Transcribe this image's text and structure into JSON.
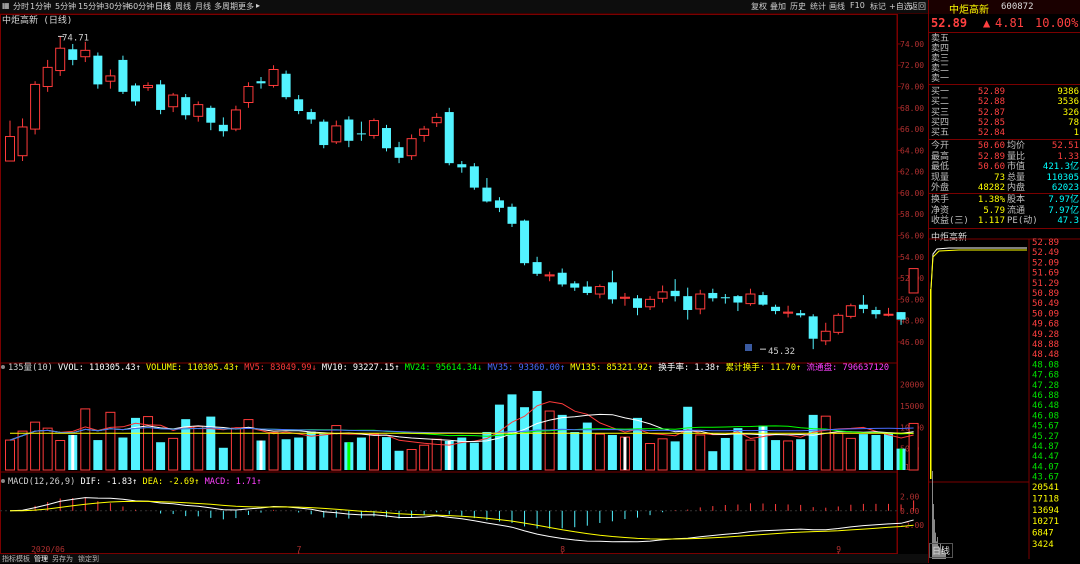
{
  "toolbar": {
    "left_items": [
      "分时",
      "1分钟",
      "5分钟",
      "15分钟",
      "30分钟",
      "60分钟",
      "日线",
      "周线",
      "月线",
      "多周期",
      "更多"
    ],
    "right_items": [
      "复权",
      "叠加",
      "历史",
      "统计",
      "画线",
      "F10",
      "标记",
      "+自选",
      "返回"
    ]
  },
  "chart": {
    "title": "中炬高新 (日线)",
    "high_label": "74.71",
    "low_label": "45.32",
    "price_axis": [
      "74.00",
      "72.00",
      "70.00",
      "68.00",
      "66.00",
      "64.00",
      "62.00",
      "60.00",
      "58.00",
      "56.00",
      "54.00",
      "52.00",
      "50.00",
      "48.00",
      "46.00"
    ],
    "date_ticks": [
      "2020/06",
      "7",
      "8",
      "9"
    ]
  },
  "volume": {
    "title": "135量(10)",
    "vvol_label": "VVOL:",
    "vvol_value": "110305.43",
    "volume_label": "VOLUME:",
    "volume_value": "110305.43",
    "mv5_label": "MV5:",
    "mv5_value": "83049.99",
    "mv10_label": "MV10:",
    "mv10_value": "93227.15",
    "mv24_label": "MV24:",
    "mv24_value": "95614.34",
    "mv35_label": "MV35:",
    "mv35_value": "93360.00",
    "mv135_label": "MV135:",
    "mv135_value": "85321.92",
    "turnover_label": "换手率:",
    "turnover_value": "1.38",
    "cum_turnover_label": "累计换手:",
    "cum_turnover_value": "11.70",
    "float_label": "流通盘:",
    "float_value": "796637120",
    "axis": [
      "20000",
      "15000",
      "10000",
      "5000"
    ],
    "unit": "X10"
  },
  "macd": {
    "title": "MACD(12,26,9)",
    "dif_label": "DIF:",
    "dif_value": "-1.83",
    "dea_label": "DEA:",
    "dea_value": "-2.69",
    "macd_label": "MACD:",
    "macd_value": "1.71",
    "axis": [
      "2.00",
      "0.00",
      "-2.00"
    ]
  },
  "bottom_tabs": [
    "指标",
    "模板",
    "管理",
    "另存为",
    "锁定到"
  ],
  "quote": {
    "name": "中炬高新",
    "code": "600872",
    "price": "52.89",
    "change": "4.81",
    "pct": "10.00%",
    "sell_labels": [
      "卖五",
      "卖四",
      "卖三",
      "卖二",
      "卖一"
    ],
    "buy": [
      {
        "label": "买一",
        "price": "52.89",
        "qty": "9386"
      },
      {
        "label": "买二",
        "price": "52.88",
        "qty": "3536"
      },
      {
        "label": "买三",
        "price": "52.87",
        "qty": "326"
      },
      {
        "label": "买四",
        "price": "52.85",
        "qty": "78"
      },
      {
        "label": "买五",
        "price": "52.84",
        "qty": "1"
      }
    ],
    "stats": [
      {
        "l1": "今开",
        "v1": "50.60",
        "l2": "均价",
        "v2": "52.51"
      },
      {
        "l1": "最高",
        "v1": "52.89",
        "l2": "量比",
        "v2": "1.33"
      },
      {
        "l1": "最低",
        "v1": "50.60",
        "l2": "市值",
        "v2": "421.3亿"
      },
      {
        "l1": "现量",
        "v1": "73",
        "l2": "总量",
        "v2": "110305"
      },
      {
        "l1": "外盘",
        "v1": "48282",
        "l2": "内盘",
        "v2": "62023"
      }
    ],
    "stats2": [
      {
        "l1": "换手",
        "v1": "1.38%",
        "l2": "股本",
        "v2": "7.97亿"
      },
      {
        "l1": "净资",
        "v1": "5.79",
        "l2": "流通",
        "v2": "7.97亿"
      },
      {
        "l1": "收益(三)",
        "v1": "1.117",
        "l2": "PE(动)",
        "v2": "47.3"
      }
    ],
    "mini_title": "中炬高新",
    "mini_axis": [
      "52.89",
      "52.49",
      "52.09",
      "51.69",
      "51.29",
      "50.89",
      "50.49",
      "50.09",
      "49.68",
      "49.28",
      "48.88",
      "48.48",
      "48.08",
      "47.68",
      "47.28",
      "46.88",
      "46.48",
      "46.08",
      "45.67",
      "45.27",
      "44.87",
      "44.47",
      "44.07",
      "43.67"
    ],
    "mini_vol_axis": [
      "20541",
      "17118",
      "13694",
      "10271",
      "6847",
      "3424"
    ],
    "mini_period": "日线"
  },
  "chart_data": {
    "type": "candlestick",
    "candles": [
      [
        63,
        65.3,
        65.0,
        66.8
      ],
      [
        63.5,
        66.2,
        63.0,
        67.0
      ],
      [
        66,
        70.2,
        65.5,
        70.5
      ],
      [
        70,
        71.8,
        69.5,
        72.5
      ],
      [
        71.5,
        73.6,
        71.0,
        74.71
      ],
      [
        73.5,
        72.5,
        72.0,
        74.0
      ],
      [
        72.8,
        73.4,
        72.3,
        74.2
      ],
      [
        72.9,
        70.2,
        69.8,
        73.2
      ],
      [
        70.5,
        71.0,
        69.8,
        71.6
      ],
      [
        72.5,
        69.5,
        69.3,
        72.9
      ],
      [
        70.1,
        68.6,
        68.2,
        70.3
      ],
      [
        69.9,
        70.1,
        69.6,
        70.4
      ],
      [
        70.2,
        67.8,
        67.4,
        70.6
      ],
      [
        68.1,
        69.2,
        67.6,
        69.4
      ],
      [
        69.0,
        67.3,
        66.9,
        69.3
      ],
      [
        67.2,
        68.3,
        66.7,
        68.6
      ],
      [
        68.0,
        66.6,
        65.9,
        68.2
      ],
      [
        66.4,
        65.8,
        65.3,
        67.1
      ],
      [
        66.0,
        67.8,
        65.8,
        68.2
      ],
      [
        68.5,
        70.0,
        68.0,
        70.4
      ],
      [
        70.5,
        70.3,
        69.8,
        70.9
      ],
      [
        70.1,
        71.6,
        69.9,
        72.0
      ],
      [
        71.2,
        69.0,
        68.8,
        71.5
      ],
      [
        68.8,
        67.7,
        67.4,
        69.2
      ],
      [
        67.6,
        66.9,
        66.5,
        67.9
      ],
      [
        66.7,
        64.5,
        64.2,
        66.9
      ],
      [
        64.8,
        66.3,
        64.6,
        66.8
      ],
      [
        66.9,
        64.9,
        64.3,
        67.2
      ],
      [
        65.6,
        65.5,
        64.9,
        66.7
      ],
      [
        65.4,
        66.8,
        65.1,
        67.0
      ],
      [
        66.1,
        64.2,
        63.9,
        66.4
      ],
      [
        64.3,
        63.3,
        62.8,
        64.8
      ],
      [
        63.5,
        65.1,
        63.1,
        65.5
      ],
      [
        65.4,
        66.0,
        64.8,
        66.3
      ],
      [
        66.6,
        67.1,
        66.2,
        67.5
      ],
      [
        67.6,
        62.8,
        62.6,
        68.0
      ],
      [
        62.7,
        62.4,
        61.9,
        63.0
      ],
      [
        62.5,
        60.5,
        60.3,
        62.8
      ],
      [
        60.5,
        59.2,
        59.1,
        61.4
      ],
      [
        59.3,
        58.6,
        58.2,
        59.6
      ],
      [
        58.7,
        57.1,
        56.8,
        59.0
      ],
      [
        57.4,
        53.4,
        53.2,
        57.5
      ],
      [
        53.5,
        52.4,
        52.2,
        54.0
      ],
      [
        52.2,
        52.3,
        51.7,
        52.6
      ],
      [
        52.5,
        51.4,
        51.2,
        52.9
      ],
      [
        51.5,
        51.1,
        50.8,
        51.7
      ],
      [
        51.2,
        50.6,
        50.4,
        51.7
      ],
      [
        50.5,
        51.2,
        50.1,
        51.4
      ],
      [
        51.6,
        50.0,
        49.6,
        52.7
      ],
      [
        50.1,
        50.2,
        49.4,
        50.6
      ],
      [
        50.1,
        49.2,
        48.5,
        50.4
      ],
      [
        49.3,
        50.0,
        49.0,
        50.3
      ],
      [
        50.1,
        50.7,
        49.7,
        51.3
      ],
      [
        50.8,
        50.3,
        49.8,
        51.9
      ],
      [
        50.3,
        49.0,
        48.1,
        51.1
      ],
      [
        49.1,
        50.5,
        48.6,
        50.9
      ],
      [
        50.6,
        50.1,
        49.8,
        51.0
      ],
      [
        50.2,
        50.1,
        49.6,
        50.5
      ],
      [
        50.3,
        49.7,
        48.9,
        50.4
      ],
      [
        49.6,
        50.5,
        49.4,
        51.0
      ],
      [
        50.4,
        49.5,
        49.4,
        50.7
      ],
      [
        49.3,
        48.9,
        48.6,
        49.5
      ],
      [
        48.7,
        48.8,
        48.3,
        49.4
      ],
      [
        48.7,
        48.5,
        48.3,
        49.0
      ],
      [
        48.4,
        46.3,
        45.32,
        48.6
      ],
      [
        46.1,
        47.0,
        45.7,
        47.8
      ],
      [
        46.9,
        48.5,
        46.7,
        48.7
      ],
      [
        48.4,
        49.4,
        48.2,
        49.6
      ],
      [
        49.5,
        49.1,
        48.7,
        50.4
      ],
      [
        49.0,
        48.6,
        48.2,
        49.3
      ],
      [
        48.6,
        48.6,
        48.4,
        49.2
      ],
      [
        48.8,
        48.1,
        47.6,
        48.8
      ],
      [
        50.6,
        52.89,
        50.6,
        52.89
      ]
    ],
    "volumes": [
      7000,
      9100,
      11200,
      9800,
      6900,
      8200,
      14300,
      7000,
      13500,
      7600,
      12200,
      12500,
      6500,
      7400,
      11900,
      10200,
      12500,
      5200,
      9800,
      11800,
      6900,
      8800,
      7200,
      7600,
      9000,
      8500,
      10400,
      6500,
      7600,
      8400,
      7700,
      4500,
      4800,
      5800,
      7200,
      6800,
      7600,
      6400,
      8900,
      15300,
      17700,
      14700,
      18500,
      13800,
      12900,
      8900,
      11100,
      8400,
      8200,
      7700,
      12200,
      6200,
      7300,
      6700,
      14800,
      8200,
      4400,
      7500,
      9800,
      7000,
      10400,
      7000,
      6800,
      7200,
      12900,
      12600,
      8600,
      7400,
      8400,
      8200,
      8500,
      5000,
      10900
    ],
    "volume_up": [
      true,
      true,
      true,
      true,
      true,
      false,
      true,
      false,
      true,
      false,
      false,
      true,
      false,
      true,
      false,
      true,
      false,
      false,
      true,
      true,
      false,
      true,
      false,
      false,
      false,
      false,
      true,
      false,
      false,
      true,
      false,
      false,
      true,
      true,
      true,
      false,
      false,
      false,
      false,
      false,
      false,
      false,
      false,
      true,
      false,
      false,
      false,
      true,
      false,
      true,
      false,
      true,
      true,
      false,
      false,
      true,
      false,
      false,
      false,
      true,
      false,
      false,
      true,
      false,
      false,
      true,
      true,
      true,
      false,
      false,
      false,
      false,
      true
    ],
    "colors": {
      "up": "#ff3b3b",
      "down": "#53f3ff",
      "mv5": "#ffffff",
      "mv10": "#ffff00",
      "mv24": "#ff00ff",
      "mv35": "#00ff00",
      "mv135": "#ffffff",
      "dif": "#ffffff",
      "dea": "#ffff00"
    }
  }
}
